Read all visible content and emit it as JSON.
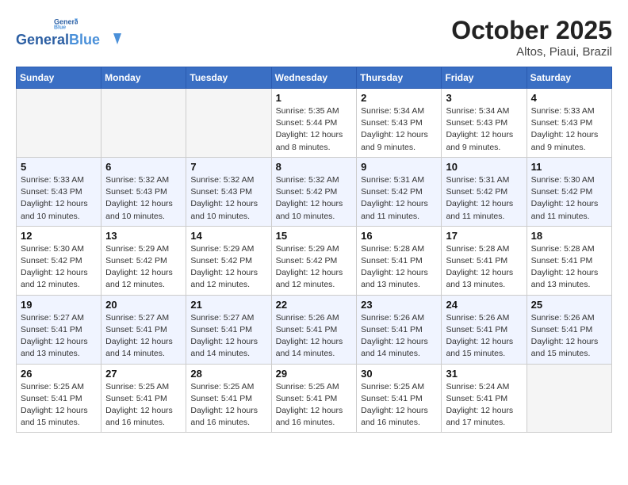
{
  "header": {
    "logo_line1": "General",
    "logo_line2": "Blue",
    "month_year": "October 2025",
    "location": "Altos, Piaui, Brazil"
  },
  "weekdays": [
    "Sunday",
    "Monday",
    "Tuesday",
    "Wednesday",
    "Thursday",
    "Friday",
    "Saturday"
  ],
  "weeks": [
    [
      {
        "num": "",
        "detail": ""
      },
      {
        "num": "",
        "detail": ""
      },
      {
        "num": "",
        "detail": ""
      },
      {
        "num": "1",
        "detail": "Sunrise: 5:35 AM\nSunset: 5:44 PM\nDaylight: 12 hours\nand 8 minutes."
      },
      {
        "num": "2",
        "detail": "Sunrise: 5:34 AM\nSunset: 5:43 PM\nDaylight: 12 hours\nand 9 minutes."
      },
      {
        "num": "3",
        "detail": "Sunrise: 5:34 AM\nSunset: 5:43 PM\nDaylight: 12 hours\nand 9 minutes."
      },
      {
        "num": "4",
        "detail": "Sunrise: 5:33 AM\nSunset: 5:43 PM\nDaylight: 12 hours\nand 9 minutes."
      }
    ],
    [
      {
        "num": "5",
        "detail": "Sunrise: 5:33 AM\nSunset: 5:43 PM\nDaylight: 12 hours\nand 10 minutes."
      },
      {
        "num": "6",
        "detail": "Sunrise: 5:32 AM\nSunset: 5:43 PM\nDaylight: 12 hours\nand 10 minutes."
      },
      {
        "num": "7",
        "detail": "Sunrise: 5:32 AM\nSunset: 5:43 PM\nDaylight: 12 hours\nand 10 minutes."
      },
      {
        "num": "8",
        "detail": "Sunrise: 5:32 AM\nSunset: 5:42 PM\nDaylight: 12 hours\nand 10 minutes."
      },
      {
        "num": "9",
        "detail": "Sunrise: 5:31 AM\nSunset: 5:42 PM\nDaylight: 12 hours\nand 11 minutes."
      },
      {
        "num": "10",
        "detail": "Sunrise: 5:31 AM\nSunset: 5:42 PM\nDaylight: 12 hours\nand 11 minutes."
      },
      {
        "num": "11",
        "detail": "Sunrise: 5:30 AM\nSunset: 5:42 PM\nDaylight: 12 hours\nand 11 minutes."
      }
    ],
    [
      {
        "num": "12",
        "detail": "Sunrise: 5:30 AM\nSunset: 5:42 PM\nDaylight: 12 hours\nand 12 minutes."
      },
      {
        "num": "13",
        "detail": "Sunrise: 5:29 AM\nSunset: 5:42 PM\nDaylight: 12 hours\nand 12 minutes."
      },
      {
        "num": "14",
        "detail": "Sunrise: 5:29 AM\nSunset: 5:42 PM\nDaylight: 12 hours\nand 12 minutes."
      },
      {
        "num": "15",
        "detail": "Sunrise: 5:29 AM\nSunset: 5:42 PM\nDaylight: 12 hours\nand 12 minutes."
      },
      {
        "num": "16",
        "detail": "Sunrise: 5:28 AM\nSunset: 5:41 PM\nDaylight: 12 hours\nand 13 minutes."
      },
      {
        "num": "17",
        "detail": "Sunrise: 5:28 AM\nSunset: 5:41 PM\nDaylight: 12 hours\nand 13 minutes."
      },
      {
        "num": "18",
        "detail": "Sunrise: 5:28 AM\nSunset: 5:41 PM\nDaylight: 12 hours\nand 13 minutes."
      }
    ],
    [
      {
        "num": "19",
        "detail": "Sunrise: 5:27 AM\nSunset: 5:41 PM\nDaylight: 12 hours\nand 13 minutes."
      },
      {
        "num": "20",
        "detail": "Sunrise: 5:27 AM\nSunset: 5:41 PM\nDaylight: 12 hours\nand 14 minutes."
      },
      {
        "num": "21",
        "detail": "Sunrise: 5:27 AM\nSunset: 5:41 PM\nDaylight: 12 hours\nand 14 minutes."
      },
      {
        "num": "22",
        "detail": "Sunrise: 5:26 AM\nSunset: 5:41 PM\nDaylight: 12 hours\nand 14 minutes."
      },
      {
        "num": "23",
        "detail": "Sunrise: 5:26 AM\nSunset: 5:41 PM\nDaylight: 12 hours\nand 14 minutes."
      },
      {
        "num": "24",
        "detail": "Sunrise: 5:26 AM\nSunset: 5:41 PM\nDaylight: 12 hours\nand 15 minutes."
      },
      {
        "num": "25",
        "detail": "Sunrise: 5:26 AM\nSunset: 5:41 PM\nDaylight: 12 hours\nand 15 minutes."
      }
    ],
    [
      {
        "num": "26",
        "detail": "Sunrise: 5:25 AM\nSunset: 5:41 PM\nDaylight: 12 hours\nand 15 minutes."
      },
      {
        "num": "27",
        "detail": "Sunrise: 5:25 AM\nSunset: 5:41 PM\nDaylight: 12 hours\nand 16 minutes."
      },
      {
        "num": "28",
        "detail": "Sunrise: 5:25 AM\nSunset: 5:41 PM\nDaylight: 12 hours\nand 16 minutes."
      },
      {
        "num": "29",
        "detail": "Sunrise: 5:25 AM\nSunset: 5:41 PM\nDaylight: 12 hours\nand 16 minutes."
      },
      {
        "num": "30",
        "detail": "Sunrise: 5:25 AM\nSunset: 5:41 PM\nDaylight: 12 hours\nand 16 minutes."
      },
      {
        "num": "31",
        "detail": "Sunrise: 5:24 AM\nSunset: 5:41 PM\nDaylight: 12 hours\nand 17 minutes."
      },
      {
        "num": "",
        "detail": ""
      }
    ]
  ]
}
